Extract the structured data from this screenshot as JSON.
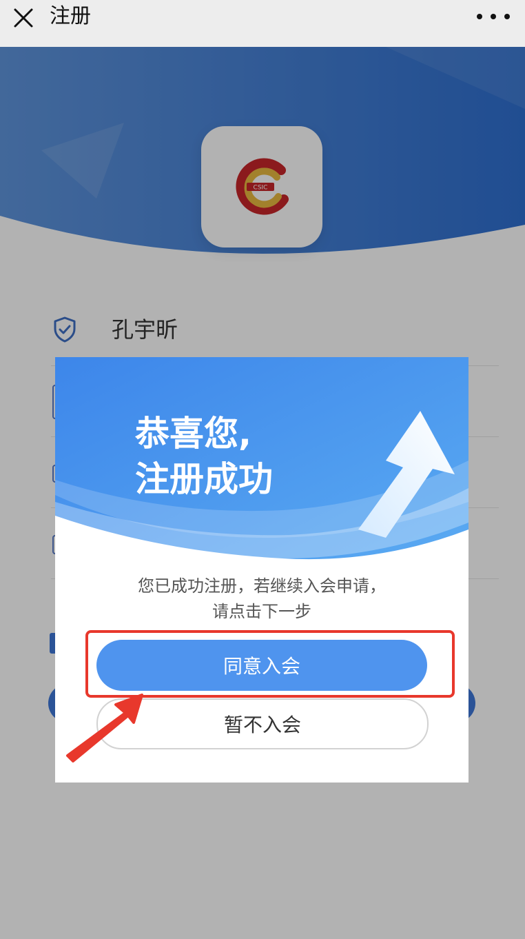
{
  "nav": {
    "title": "注册",
    "close_icon": "close-icon",
    "more_icon": "more-icon"
  },
  "form": {
    "name_value": "孔宇昕",
    "logo_text": "CSIC"
  },
  "modal": {
    "title_line1": "恭喜您,",
    "title_line2": "注册成功",
    "message_line1": "您已成功注册，若继续入会申请，",
    "message_line2": "请点击下一步",
    "join_label": "同意入会",
    "decline_label": "暂不入会"
  },
  "colors": {
    "primary_blue": "#4f94ee",
    "banner_blue": "#2f6fd0",
    "annotation_red": "#e8382c",
    "logo_red": "#c8262a",
    "logo_gold": "#e9b93f"
  }
}
